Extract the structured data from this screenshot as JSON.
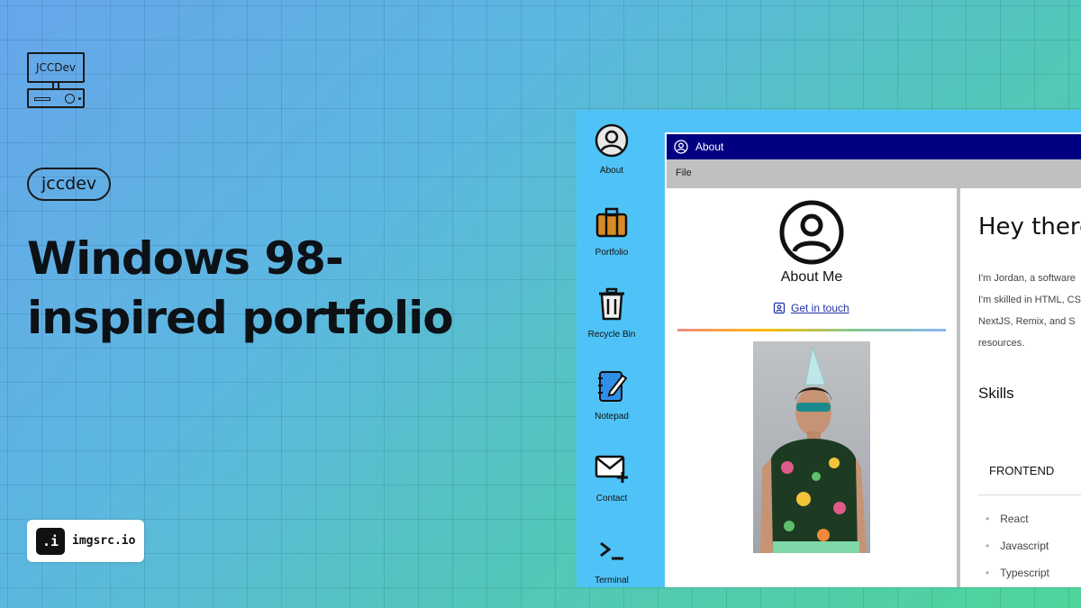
{
  "logo": {
    "screen_text": "JCCDev"
  },
  "tag": "jccdev",
  "headline": {
    "line1": "Windows 98-",
    "line2": "inspired portfolio"
  },
  "badge": {
    "mark": ".i",
    "text": "imgsrc.io"
  },
  "desktop": {
    "icons": [
      {
        "label": "About",
        "icon": "user-circle-icon"
      },
      {
        "label": "Portfolio",
        "icon": "briefcase-icon"
      },
      {
        "label": "Recycle Bin",
        "icon": "trash-icon"
      },
      {
        "label": "Notepad",
        "icon": "notepad-icon"
      },
      {
        "label": "Contact",
        "icon": "mail-icon"
      },
      {
        "label": "Terminal",
        "icon": "terminal-icon"
      }
    ],
    "background_color": "#4fc3f7"
  },
  "window": {
    "title": "About",
    "menu": [
      "File"
    ],
    "left": {
      "heading": "About Me",
      "link": "Get in touch"
    },
    "right": {
      "heading": "Hey there",
      "intro_lines": [
        "I'm Jordan, a software",
        "I'm skilled in HTML, CS",
        "NextJS, Remix, and S",
        "resources."
      ],
      "skills_title": "Skills",
      "category": "FRONTEND",
      "skills": [
        "React",
        "Javascript",
        "Typescript"
      ]
    },
    "titlebar_color": "#000080"
  }
}
